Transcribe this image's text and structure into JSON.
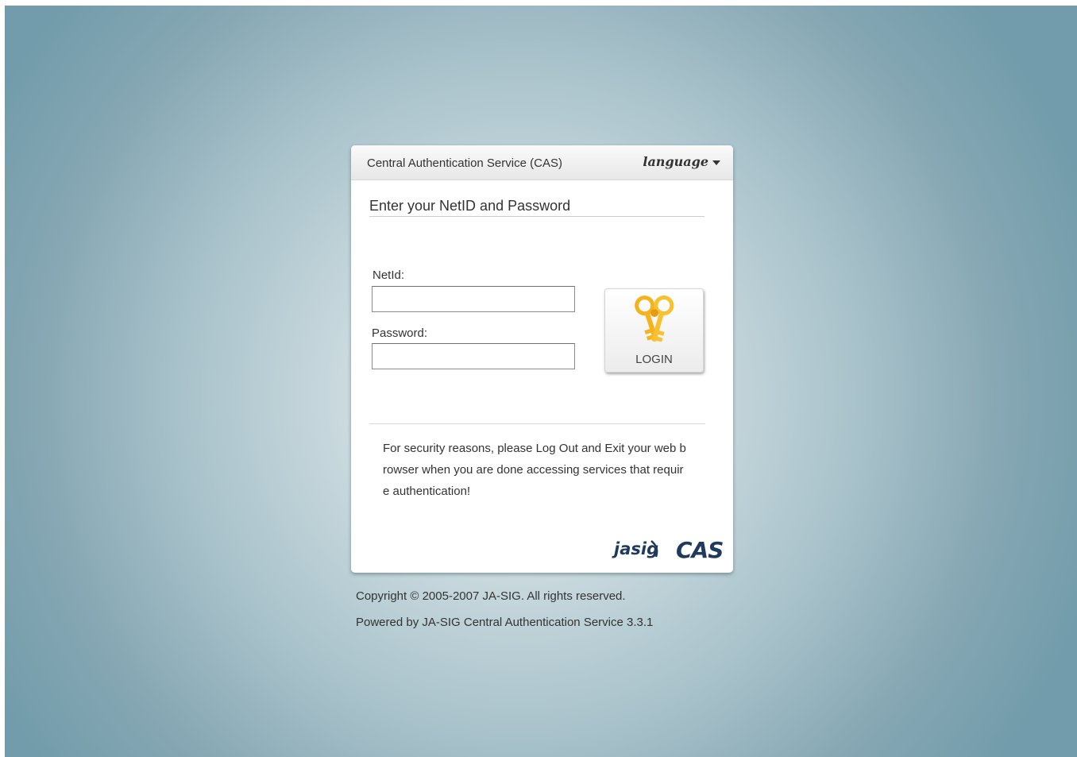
{
  "header": {
    "title": "Central Authentication Service (CAS)",
    "language_label": "language"
  },
  "form": {
    "title": "Enter your NetID and Password",
    "netid_label": "NetId:",
    "netid_value": "",
    "password_label": "Password:",
    "password_value": "",
    "login_label": "LOGIN"
  },
  "notice": {
    "security_text": "For security reasons, please Log Out and Exit your web browser when you are done accessing services that require authentication!"
  },
  "logos": {
    "jasig": "jasig",
    "cas": "CAS"
  },
  "footer": {
    "copyright": "Copyright © 2005-2007 JA-SIG. All rights reserved.",
    "powered_by": "Powered by JA-SIG Central Authentication Service 3.3.1"
  },
  "colors": {
    "background_center": "#e3eced",
    "background_edge": "#729cab",
    "key_gold": "#f5b21a",
    "logo_navy": "#1f3a5c"
  },
  "icons": {
    "login_icon": "keys-icon",
    "language_icon": "caret-down-icon"
  }
}
